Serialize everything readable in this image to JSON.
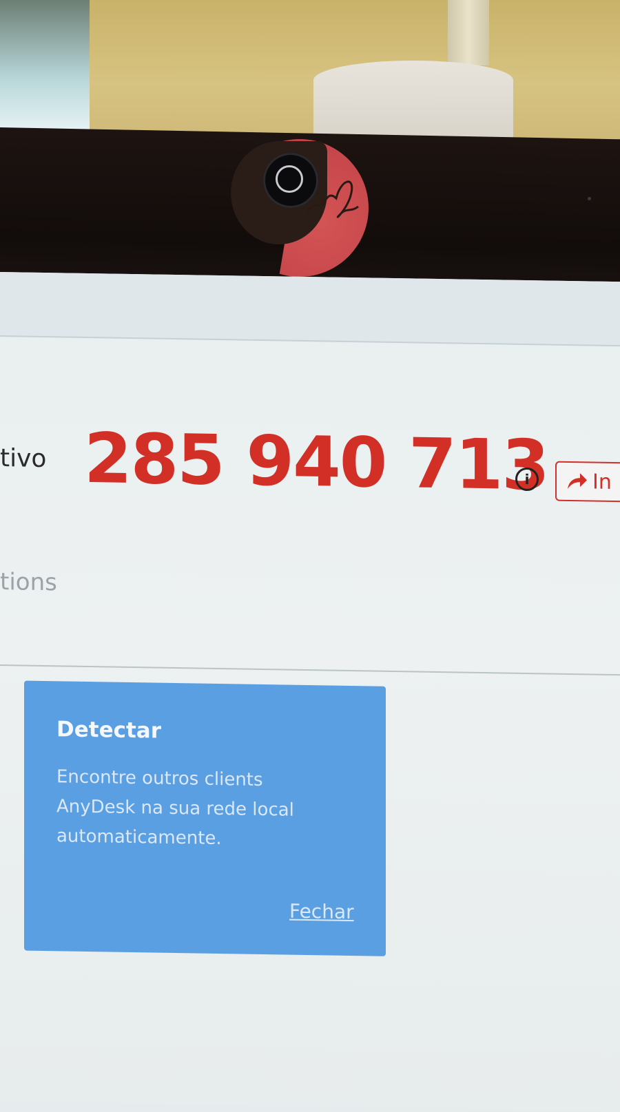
{
  "session": {
    "id_label": "tivo",
    "address": "285 940 713",
    "invite_label": "In"
  },
  "nav": {
    "options_label": "tions"
  },
  "discover_card": {
    "title": "Detectar",
    "description": "Encontre outros clients AnyDesk na sua rede local automaticamente.",
    "close_label": "Fechar"
  },
  "colors": {
    "address": "#d22f27",
    "card_background": "#5b9fe3",
    "screen_background": "#e9eff0"
  },
  "icons": {
    "info": "info-icon",
    "invite": "share-arrow-icon",
    "webcam": "webcam-icon"
  }
}
